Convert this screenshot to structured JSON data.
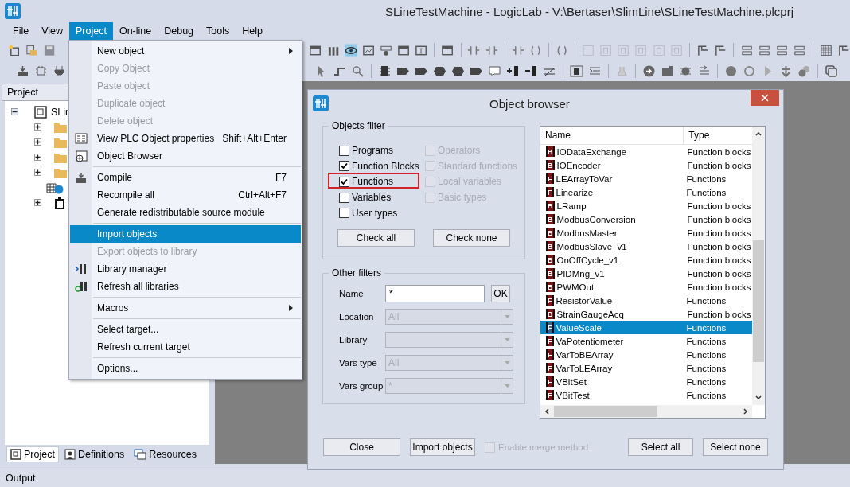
{
  "window": {
    "title": "SLineTestMachine - LogicLab - V:\\Bertaser\\SlimLine\\SLineTestMachine.plcprj"
  },
  "menu_bar": [
    {
      "label": "File",
      "selected": false
    },
    {
      "label": "View",
      "selected": false
    },
    {
      "label": "Project",
      "selected": true
    },
    {
      "label": "On-line",
      "selected": false
    },
    {
      "label": "Debug",
      "selected": false
    },
    {
      "label": "Tools",
      "selected": false
    },
    {
      "label": "Help",
      "selected": false
    }
  ],
  "project_menu": [
    {
      "kind": "item",
      "label": "New object",
      "disabled": false,
      "submenu": true,
      "selected": false
    },
    {
      "kind": "item",
      "label": "Copy Object",
      "disabled": true,
      "submenu": false,
      "selected": false
    },
    {
      "kind": "item",
      "label": "Paste object",
      "disabled": true,
      "submenu": false,
      "selected": false
    },
    {
      "kind": "item",
      "label": "Duplicate object",
      "disabled": true,
      "submenu": false,
      "selected": false
    },
    {
      "kind": "item",
      "label": "Delete object",
      "disabled": true,
      "submenu": false,
      "selected": false
    },
    {
      "kind": "item",
      "label": "View PLC Object properties",
      "shortcut": "Shift+Alt+Enter",
      "disabled": false,
      "submenu": false,
      "selected": false
    },
    {
      "kind": "item",
      "label": "Object Browser",
      "disabled": false,
      "submenu": false,
      "selected": false
    },
    {
      "kind": "separator"
    },
    {
      "kind": "item",
      "label": "Compile",
      "shortcut": "F7",
      "disabled": false,
      "submenu": false,
      "selected": false
    },
    {
      "kind": "item",
      "label": "Recompile all",
      "shortcut": "Ctrl+Alt+F7",
      "disabled": false,
      "submenu": false,
      "selected": false
    },
    {
      "kind": "item",
      "label": "Generate redistributable source module",
      "disabled": false,
      "submenu": false,
      "selected": false
    },
    {
      "kind": "separator"
    },
    {
      "kind": "item",
      "label": "Import objects",
      "disabled": false,
      "submenu": false,
      "selected": true
    },
    {
      "kind": "item",
      "label": "Export objects to library",
      "disabled": true,
      "submenu": false,
      "selected": false
    },
    {
      "kind": "item",
      "label": "Library manager",
      "disabled": false,
      "submenu": false,
      "selected": false
    },
    {
      "kind": "item",
      "label": "Refresh all libraries",
      "disabled": false,
      "submenu": false,
      "selected": false
    },
    {
      "kind": "separator"
    },
    {
      "kind": "item",
      "label": "Macros",
      "disabled": false,
      "submenu": true,
      "selected": false
    },
    {
      "kind": "separator"
    },
    {
      "kind": "item",
      "label": "Select target...",
      "disabled": false,
      "submenu": false,
      "selected": false
    },
    {
      "kind": "item",
      "label": "Refresh current target",
      "disabled": false,
      "submenu": false,
      "selected": false
    },
    {
      "kind": "separator"
    },
    {
      "kind": "item",
      "label": "Options...",
      "disabled": false,
      "submenu": false,
      "selected": false
    }
  ],
  "project_panel": {
    "title": "Project",
    "tree": [
      {
        "label": "SLin",
        "kind": "project",
        "expanded": true,
        "children": [
          {
            "kind": "folder",
            "expanded": false
          },
          {
            "kind": "folder",
            "expanded": false
          },
          {
            "kind": "folder",
            "expanded": false
          },
          {
            "kind": "folder",
            "expanded": false
          },
          {
            "kind": "globals"
          },
          {
            "kind": "target",
            "expanded": false
          }
        ]
      }
    ],
    "tabs": [
      {
        "label": "Project",
        "selected": true
      },
      {
        "label": "Definitions",
        "selected": false
      },
      {
        "label": "Resources",
        "selected": false
      }
    ]
  },
  "object_browser": {
    "title": "Object browser",
    "objects_filter": {
      "title": "Objects filter",
      "options": [
        {
          "label": "Programs",
          "checked": false,
          "disabled": false,
          "highlighted": false
        },
        {
          "label": "Operators",
          "checked": false,
          "disabled": true,
          "highlighted": false
        },
        {
          "label": "Function Blocks",
          "checked": true,
          "disabled": false,
          "highlighted": false
        },
        {
          "label": "Standard functions",
          "checked": false,
          "disabled": true,
          "highlighted": false
        },
        {
          "label": "Functions",
          "checked": true,
          "disabled": false,
          "highlighted": true
        },
        {
          "label": "Local variables",
          "checked": false,
          "disabled": true,
          "highlighted": false
        },
        {
          "label": "Variables",
          "checked": false,
          "disabled": false,
          "highlighted": false
        },
        {
          "label": "Basic types",
          "checked": false,
          "disabled": true,
          "highlighted": false
        },
        {
          "label": "User types",
          "checked": false,
          "disabled": false,
          "highlighted": false
        }
      ],
      "buttons": [
        "Check all",
        "Check none"
      ]
    },
    "other_filters": {
      "title": "Other filters",
      "name": {
        "label": "Name",
        "value": "*",
        "button": "OK"
      },
      "selects": [
        {
          "label": "Location",
          "value": "All",
          "disabled": true
        },
        {
          "label": "Library",
          "disabled": true
        },
        {
          "label": "Vars type",
          "value": "All",
          "disabled": true
        },
        {
          "label": "Vars group",
          "value": "*",
          "disabled": true
        }
      ]
    },
    "list": {
      "columns": [
        "Name",
        "Type"
      ],
      "rows": [
        {
          "badge": "B",
          "name": "IODataExchange",
          "type": "Function blocks",
          "selected": false
        },
        {
          "badge": "B",
          "name": "IOEncoder",
          "type": "Function blocks",
          "selected": false
        },
        {
          "badge": "F",
          "name": "LEArrayToVar",
          "type": "Functions",
          "selected": false
        },
        {
          "badge": "F",
          "name": "Linearize",
          "type": "Functions",
          "selected": false
        },
        {
          "badge": "B",
          "name": "LRamp",
          "type": "Function blocks",
          "selected": false
        },
        {
          "badge": "B",
          "name": "ModbusConversion",
          "type": "Function blocks",
          "selected": false
        },
        {
          "badge": "B",
          "name": "ModbusMaster",
          "type": "Function blocks",
          "selected": false
        },
        {
          "badge": "B",
          "name": "ModbusSlave_v1",
          "type": "Function blocks",
          "selected": false
        },
        {
          "badge": "B",
          "name": "OnOffCycle_v1",
          "type": "Function blocks",
          "selected": false
        },
        {
          "badge": "B",
          "name": "PIDMng_v1",
          "type": "Function blocks",
          "selected": false
        },
        {
          "badge": "B",
          "name": "PWMOut",
          "type": "Function blocks",
          "selected": false
        },
        {
          "badge": "F",
          "name": "ResistorValue",
          "type": "Functions",
          "selected": false
        },
        {
          "badge": "B",
          "name": "StrainGaugeAcq",
          "type": "Function blocks",
          "selected": false
        },
        {
          "badge": "F",
          "name": "ValueScale",
          "type": "Functions",
          "selected": true
        },
        {
          "badge": "F",
          "name": "VaPotentiometer",
          "type": "Functions",
          "selected": false
        },
        {
          "badge": "F",
          "name": "VarToBEArray",
          "type": "Functions",
          "selected": false
        },
        {
          "badge": "F",
          "name": "VarToLEArray",
          "type": "Functions",
          "selected": false
        },
        {
          "badge": "F",
          "name": "VBitSet",
          "type": "Functions",
          "selected": false
        },
        {
          "badge": "F",
          "name": "VBitTest",
          "type": "Functions",
          "selected": false
        }
      ]
    },
    "footer": {
      "close": "Close",
      "import": "Import objects",
      "merge": {
        "label": "Enable merge method",
        "checked": false,
        "disabled": true
      },
      "select_all": "Select all",
      "select_none": "Select none"
    }
  },
  "output_panel": {
    "title": "Output"
  }
}
